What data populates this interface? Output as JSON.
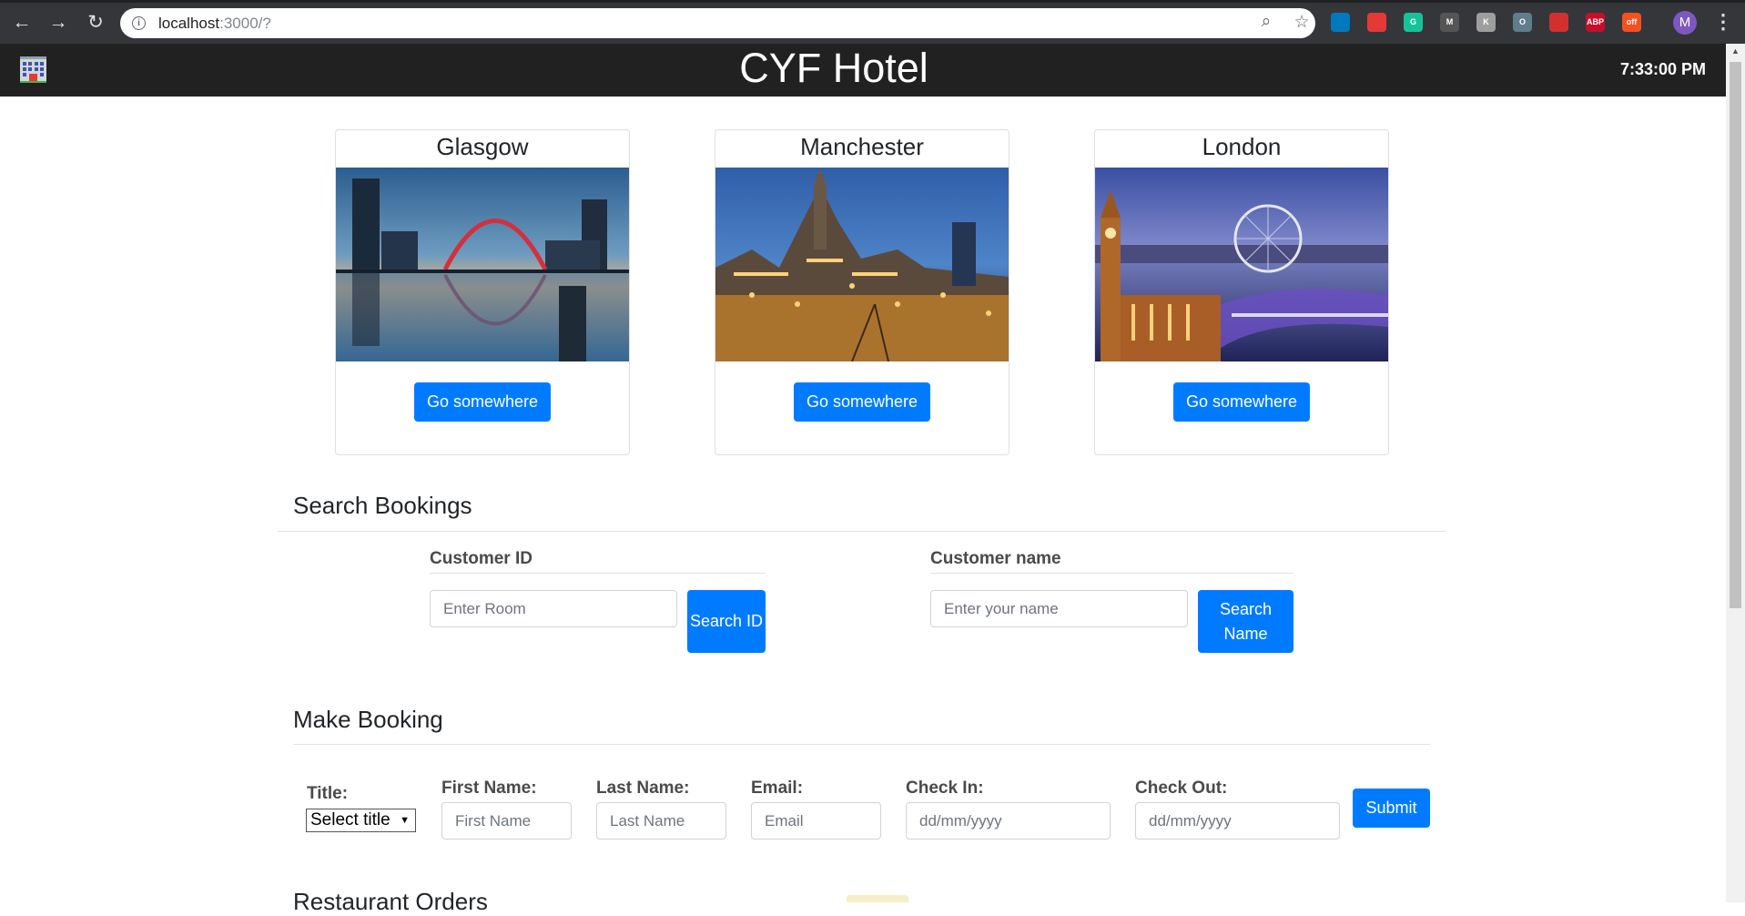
{
  "browser": {
    "url_host": "localhost",
    "url_path": ":3000/?",
    "profile_initial": "M",
    "extensions": [
      {
        "name": "trello-icon",
        "color": "#0079bf",
        "text": ""
      },
      {
        "name": "stop-hand-icon",
        "color": "#e53935",
        "text": ""
      },
      {
        "name": "grammarly-icon",
        "color": "#15c39a",
        "text": "G"
      },
      {
        "name": "mendeley-icon",
        "color": "#555555",
        "text": "M"
      },
      {
        "name": "kyc-icon",
        "color": "#9e9e9e",
        "text": "K"
      },
      {
        "name": "circle-ext-icon",
        "color": "#607d8b",
        "text": "O"
      },
      {
        "name": "bug-ext-icon",
        "color": "#d32f2f",
        "text": ""
      },
      {
        "name": "adblock-plus-icon",
        "color": "#c70d2c",
        "text": "ABP"
      },
      {
        "name": "off-ext-icon",
        "color": "#f4511e",
        "text": "off"
      }
    ]
  },
  "header": {
    "title": "CYF Hotel",
    "clock": "7:33:00 PM"
  },
  "cities": [
    {
      "name": "Glasgow",
      "button": "Go somewhere"
    },
    {
      "name": "Manchester",
      "button": "Go somewhere"
    },
    {
      "name": "London",
      "button": "Go somewhere"
    }
  ],
  "search": {
    "heading": "Search Bookings",
    "customer_id_label": "Customer ID",
    "customer_id_placeholder": "Enter Room",
    "search_id_button": "Search ID",
    "customer_name_label": "Customer name",
    "customer_name_placeholder": "Enter your name",
    "search_name_button": "Search Name"
  },
  "booking": {
    "heading": "Make Booking",
    "title_label": "Title:",
    "title_select_value": "Select title",
    "first_name_label": "First Name:",
    "first_name_placeholder": "First Name",
    "last_name_label": "Last Name:",
    "last_name_placeholder": "Last Name",
    "email_label": "Email:",
    "email_placeholder": "Email",
    "check_in_label": "Check In:",
    "check_in_placeholder": "dd/mm/yyyy",
    "check_out_label": "Check Out:",
    "check_out_placeholder": "dd/mm/yyyy",
    "submit_button": "Submit"
  },
  "restaurant": {
    "heading": "Restaurant Orders"
  }
}
